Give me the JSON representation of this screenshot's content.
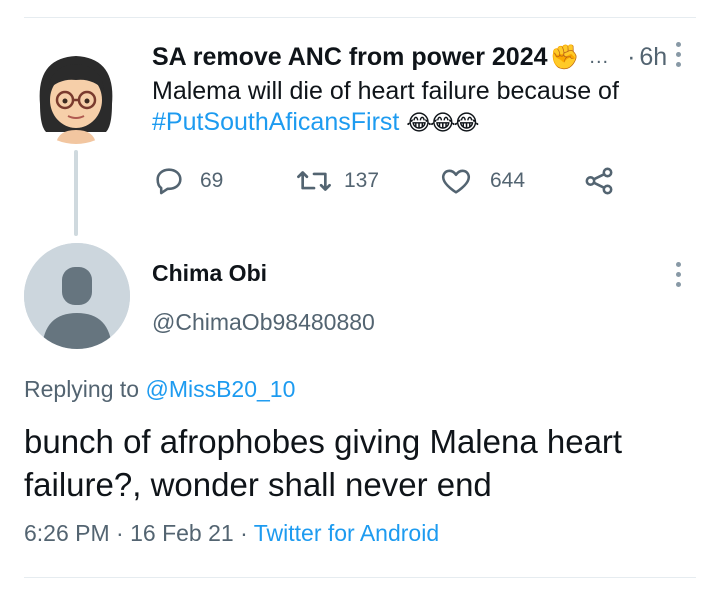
{
  "parent_tweet": {
    "author_name": "SA remove ANC from power 2024",
    "name_emoji": "✊",
    "name_overflow": "...",
    "separator": "·",
    "time": "6h",
    "text_line1": "Malema will die of heart failure because of",
    "hashtag": "#PutSouthAficansFirst",
    "laugh_emojis": "😂😂😂",
    "reply_count": "69",
    "retweet_count": "137",
    "like_count": "644",
    "icons": [
      "reply-icon",
      "retweet-icon",
      "like-icon",
      "share-icon",
      "more-icon"
    ]
  },
  "reply_tweet": {
    "author_name": "Chima Obi",
    "handle": "@ChimaOb98480880",
    "replying_prefix": "Replying to",
    "replying_to": "@MissB20_10",
    "text": "bunch of afrophobes giving Malena heart failure?, wonder shall never end",
    "time": "6:26 PM",
    "separator1": "·",
    "date": "16 Feb 21",
    "separator2": "·",
    "source": "Twitter for Android"
  },
  "colors": {
    "link": "#1d9bf0",
    "secondary_text": "#536471",
    "thread_line": "#cfd9de",
    "default_avatar_bg": "#ccd6dd"
  }
}
